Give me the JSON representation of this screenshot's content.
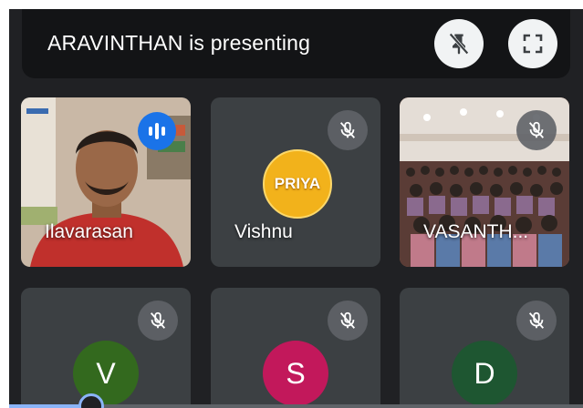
{
  "banner": {
    "presenting_text": "ARAVINTHAN is presenting",
    "buttons": [
      {
        "icon": "unpin-icon",
        "label": ""
      },
      {
        "icon": "fullscreen-icon",
        "label": ""
      }
    ]
  },
  "tiles": [
    {
      "name": "Ilavarasan",
      "type": "video",
      "muted": false,
      "speaking": true
    },
    {
      "name": "Vishnu",
      "type": "logo",
      "logo_text": "PRIYA",
      "muted": true
    },
    {
      "name": "VASANTH...",
      "type": "video",
      "muted": true
    },
    {
      "name": "",
      "type": "avatar",
      "initial": "V",
      "avatar_color": "#33691e",
      "muted": true
    },
    {
      "name": "",
      "type": "avatar",
      "initial": "S",
      "avatar_color": "#c2185b",
      "muted": true
    },
    {
      "name": "",
      "type": "avatar",
      "initial": "D",
      "avatar_color": "#1e5631",
      "muted": true
    }
  ],
  "colors": {
    "background": "#202124",
    "tile": "#3c4043",
    "accent": "#1a73e8"
  }
}
